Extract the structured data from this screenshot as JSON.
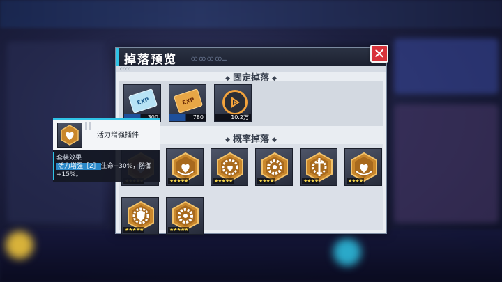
{
  "dialog": {
    "title": "掉落预览",
    "title_deco": "ꝎꝎꝎꝎ꜡꜡꜡",
    "sub_deco": "ꞒꞒꞒꞒ",
    "close_label": "✕",
    "fixed_section": "固定掉落",
    "concept_section": "概率掉落",
    "section_marker": "◆"
  },
  "fixed_items": [
    {
      "name": "exp-ticket-small",
      "label": "EXP",
      "count": "300",
      "style": "blue"
    },
    {
      "name": "exp-ticket-large",
      "label": "EXP",
      "count": "780",
      "style": "gold"
    },
    {
      "name": "coin",
      "label": "",
      "count": "10.2万",
      "style": "coin"
    }
  ],
  "concept_chips": [
    {
      "icon": "heart-shield-chip-icon",
      "stars": "★★★★★"
    },
    {
      "icon": "heart-hands-chip-icon",
      "stars": "★★★★★"
    },
    {
      "icon": "heart-gear-chip-icon",
      "stars": "★★★★★"
    },
    {
      "icon": "gear-chip-icon",
      "stars": "★★★★"
    },
    {
      "icon": "sword-gear-chip-icon",
      "stars": "★★★★"
    },
    {
      "icon": "heart-hands-chip-icon",
      "stars": "★★★★"
    },
    {
      "icon": "shield-gear-chip-icon",
      "stars": "★★★★★"
    },
    {
      "icon": "gear-chip-icon",
      "stars": "★★★★★"
    }
  ],
  "tooltip": {
    "name": "活力增强插件",
    "set_title": "套装效果",
    "tag": "活力增强［2］",
    "effect": "生命+30%，防御+15%。",
    "stars": "★★★★★"
  },
  "colors": {
    "accent": "#2fc3e6",
    "close_red": "#d8323a",
    "gold": "#e3a13a"
  }
}
